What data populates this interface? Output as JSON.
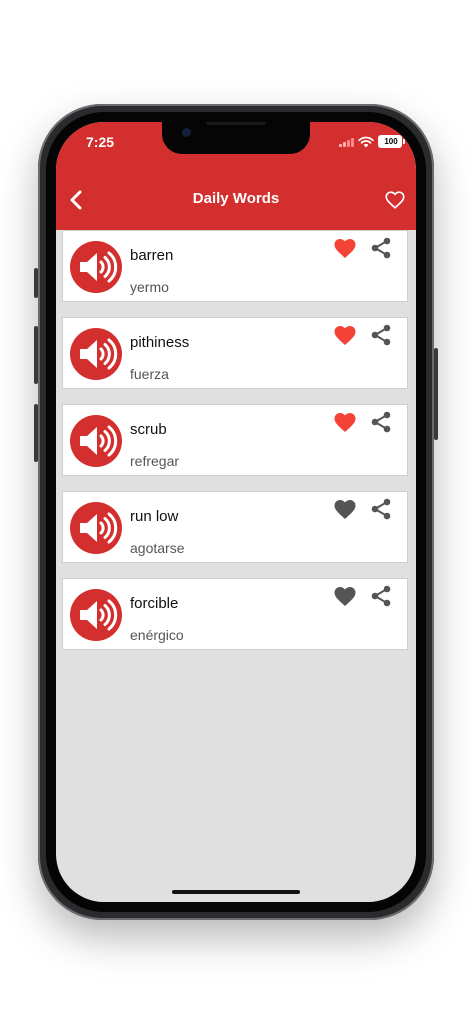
{
  "status_bar": {
    "time": "7:25",
    "battery": "100"
  },
  "header": {
    "title": "Daily Words"
  },
  "colors": {
    "brand": "#d32f2f",
    "favorite_on": "#f44336",
    "favorite_off": "#555555"
  },
  "words": [
    {
      "word": "barren",
      "translation": "yermo",
      "favorite": true
    },
    {
      "word": "pithiness",
      "translation": "fuerza",
      "favorite": true
    },
    {
      "word": "scrub",
      "translation": "refregar",
      "favorite": true
    },
    {
      "word": "run low",
      "translation": "agotarse",
      "favorite": false
    },
    {
      "word": "forcible",
      "translation": "enérgico",
      "favorite": false
    }
  ]
}
